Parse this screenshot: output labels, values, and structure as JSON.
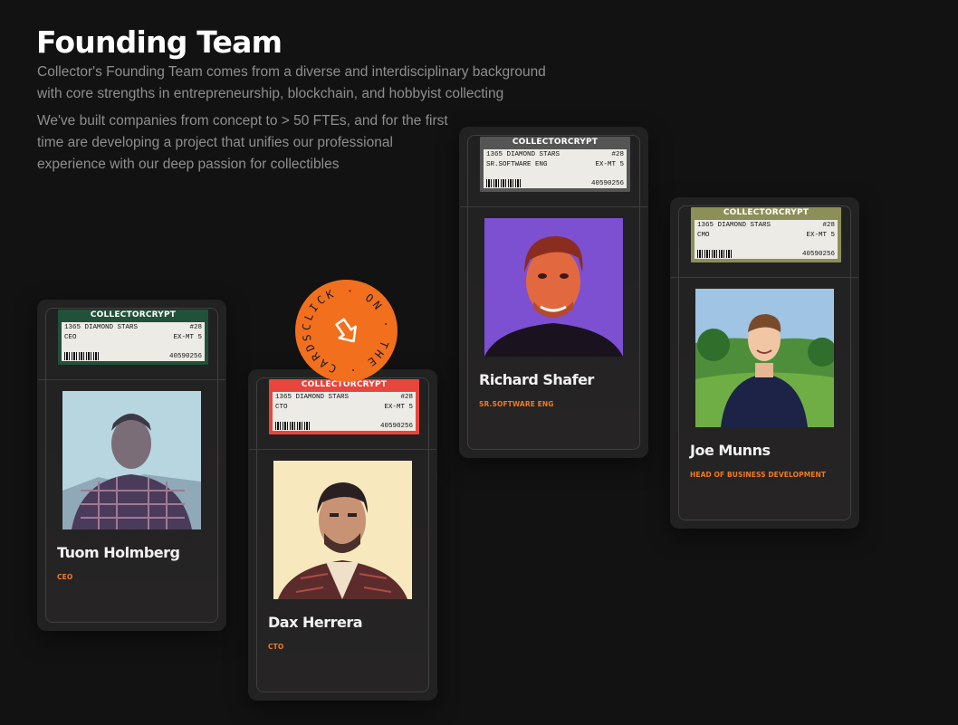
{
  "section": {
    "title": "Founding Team",
    "paragraph1": "Collector's Founding Team comes from a diverse and interdisciplinary background with core strengths in entrepreneurship, blockchain, and hobbyist collecting",
    "paragraph2": "We've built companies from concept to > 50 FTEs, and for the first time are developing a project that unifies our professional experience with our deep passion for collectibles"
  },
  "badge": {
    "text": "CLICK · ON · THE · CARDS ·",
    "icon": "arrow-down-left-icon",
    "color": "#f26f1d"
  },
  "cards": [
    {
      "brand": "COLLECTORCRYPT",
      "set": "1365 DIAMOND STARS",
      "number": "#28",
      "position": "CEO",
      "grade": "EX-MT 5",
      "serial": "40590256",
      "name": "Tuom Holmberg",
      "role": "CEO",
      "label_color": "#22513a"
    },
    {
      "brand": "COLLECTORCRYPT",
      "set": "1365 DIAMOND STARS",
      "number": "#28",
      "position": "CTO",
      "grade": "EX-MT 5",
      "serial": "40590256",
      "name": "Dax Herrera",
      "role": "CTO",
      "label_color": "#e9453d"
    },
    {
      "brand": "COLLECTORCRYPT",
      "set": "1365 DIAMOND STARS",
      "number": "#28",
      "position": "SR.SOFTWARE ENG",
      "grade": "EX-MT 5",
      "serial": "40590256",
      "name": "Richard Shafer",
      "role": "SR.SOFTWARE ENG",
      "label_color": "#555555"
    },
    {
      "brand": "COLLECTORCRYPT",
      "set": "1365 DIAMOND STARS",
      "number": "#28",
      "position": "CMO",
      "grade": "EX-MT 5",
      "serial": "40590256",
      "name": "Joe Munns",
      "role": "HEAD OF BUSINESS DEVELOPMENT",
      "label_color": "#8d8f58"
    }
  ],
  "accent_color": "#ef7a22"
}
